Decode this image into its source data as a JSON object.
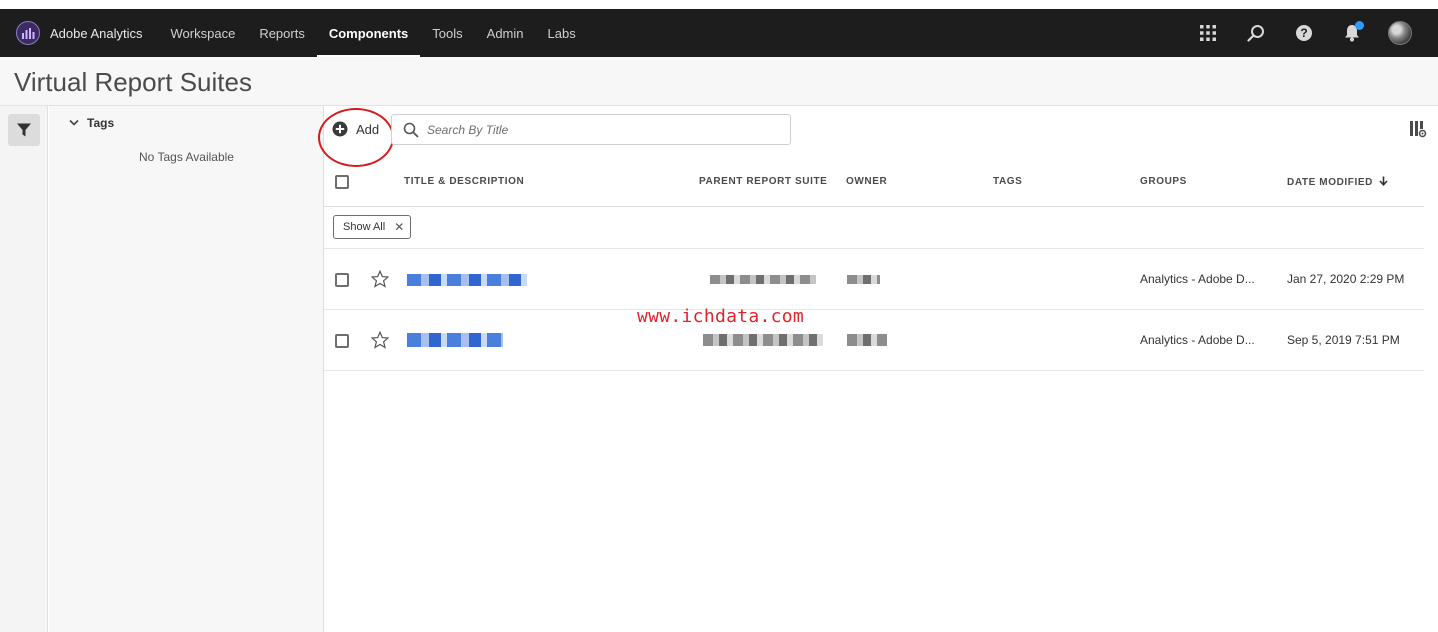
{
  "app": {
    "name": "Adobe Analytics",
    "logo_icon": "adobe-analytics-logo-icon"
  },
  "nav": {
    "items": [
      {
        "label": "Workspace",
        "active": false
      },
      {
        "label": "Reports",
        "active": false
      },
      {
        "label": "Components",
        "active": true
      },
      {
        "label": "Tools",
        "active": false
      },
      {
        "label": "Admin",
        "active": false
      },
      {
        "label": "Labs",
        "active": false
      }
    ],
    "right_icons": [
      "apps-grid-icon",
      "search-icon",
      "help-icon",
      "bell-icon",
      "user-avatar"
    ]
  },
  "page": {
    "title": "Virtual Report Suites"
  },
  "tags_panel": {
    "title": "Tags",
    "empty_text": "No Tags Available"
  },
  "toolbar": {
    "add_label": "Add",
    "search_placeholder": "Search By Title"
  },
  "table": {
    "columns": [
      "TITLE & DESCRIPTION",
      "PARENT REPORT SUITE",
      "OWNER",
      "TAGS",
      "GROUPS",
      "DATE MODIFIED"
    ],
    "sort_column": "DATE MODIFIED",
    "sort_direction": "descending",
    "filter_chip": "Show All",
    "rows": [
      {
        "groups": "Analytics - Adobe D...",
        "date_modified": "Jan 27, 2020 2:29 PM"
      },
      {
        "groups": "Analytics - Adobe D...",
        "date_modified": "Sep 5, 2019 7:51 PM"
      }
    ]
  },
  "watermark": "www.ichdata.com",
  "colors": {
    "nav_bg": "#1d1d1d",
    "link_blue": "#2f66d0",
    "annotation_red": "#d61b1b",
    "notification_blue": "#2d9cff"
  }
}
